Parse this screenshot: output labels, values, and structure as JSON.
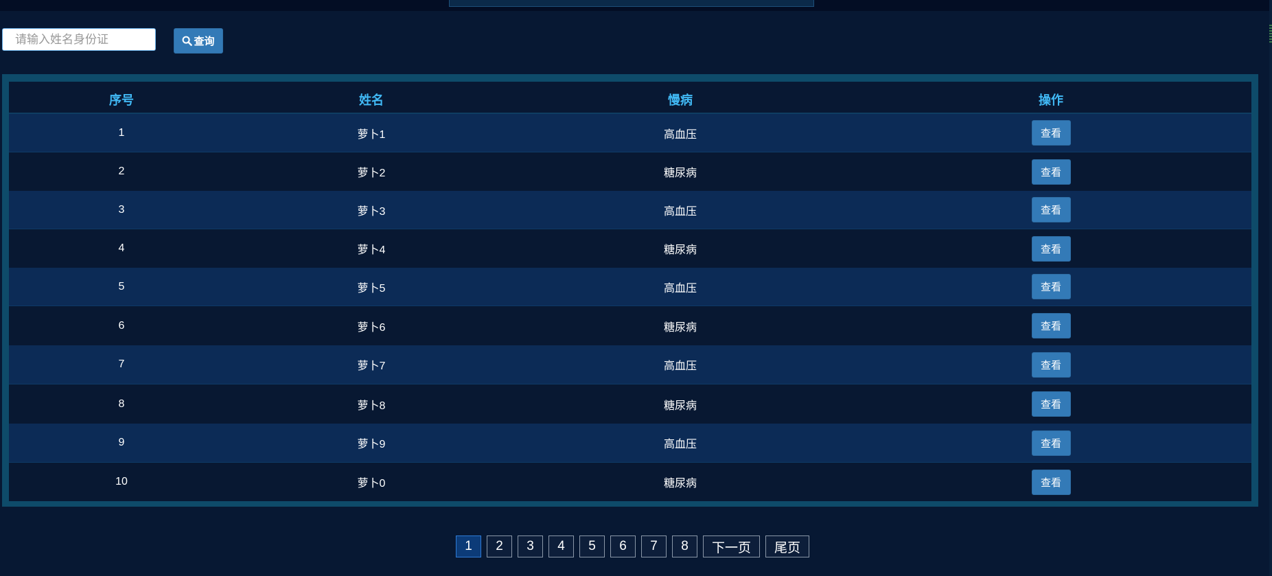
{
  "search": {
    "placeholder": "请输入姓名身份证",
    "button_label": "查询"
  },
  "table": {
    "headers": [
      "序号",
      "姓名",
      "慢病",
      "操作"
    ],
    "rows": [
      {
        "index": "1",
        "name": "萝卜1",
        "disease": "高血压",
        "action": "查看"
      },
      {
        "index": "2",
        "name": "萝卜2",
        "disease": "糖尿病",
        "action": "查看"
      },
      {
        "index": "3",
        "name": "萝卜3",
        "disease": "高血压",
        "action": "查看"
      },
      {
        "index": "4",
        "name": "萝卜4",
        "disease": "糖尿病",
        "action": "查看"
      },
      {
        "index": "5",
        "name": "萝卜5",
        "disease": "高血压",
        "action": "查看"
      },
      {
        "index": "6",
        "name": "萝卜6",
        "disease": "糖尿病",
        "action": "查看"
      },
      {
        "index": "7",
        "name": "萝卜7",
        "disease": "高血压",
        "action": "查看"
      },
      {
        "index": "8",
        "name": "萝卜8",
        "disease": "糖尿病",
        "action": "查看"
      },
      {
        "index": "9",
        "name": "萝卜9",
        "disease": "高血压",
        "action": "查看"
      },
      {
        "index": "10",
        "name": "萝卜0",
        "disease": "糖尿病",
        "action": "查看"
      }
    ]
  },
  "pagination": {
    "pages": [
      "1",
      "2",
      "3",
      "4",
      "5",
      "6",
      "7",
      "8"
    ],
    "current": "1",
    "next_label": "下一页",
    "last_label": "尾页"
  },
  "colors": {
    "background": "#071833",
    "header_text": "#41b9f5",
    "button": "#337ab7",
    "frame": "#0e4b6a",
    "row_alt": "#0c2b56"
  },
  "icons": {
    "search_button_icon": "search-icon"
  }
}
